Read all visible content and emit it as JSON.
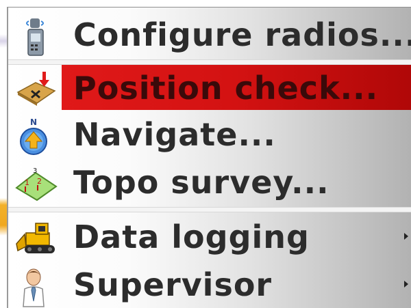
{
  "menu": {
    "items": [
      {
        "label": "Configure radios...",
        "icon": "radio-icon",
        "selected": false,
        "submenu": false
      },
      {
        "label": "Position check...",
        "icon": "position-check-icon",
        "selected": true,
        "submenu": false
      },
      {
        "label": "Navigate...",
        "icon": "navigate-icon",
        "selected": false,
        "submenu": false
      },
      {
        "label": "Topo survey...",
        "icon": "topo-survey-icon",
        "selected": false,
        "submenu": false
      },
      {
        "label": "Data logging",
        "icon": "bulldozer-icon",
        "selected": false,
        "submenu": true
      },
      {
        "label": "Supervisor",
        "icon": "supervisor-icon",
        "selected": false,
        "submenu": true
      }
    ]
  },
  "colors": {
    "highlight": "#d31212",
    "text": "#2c2c2c"
  }
}
